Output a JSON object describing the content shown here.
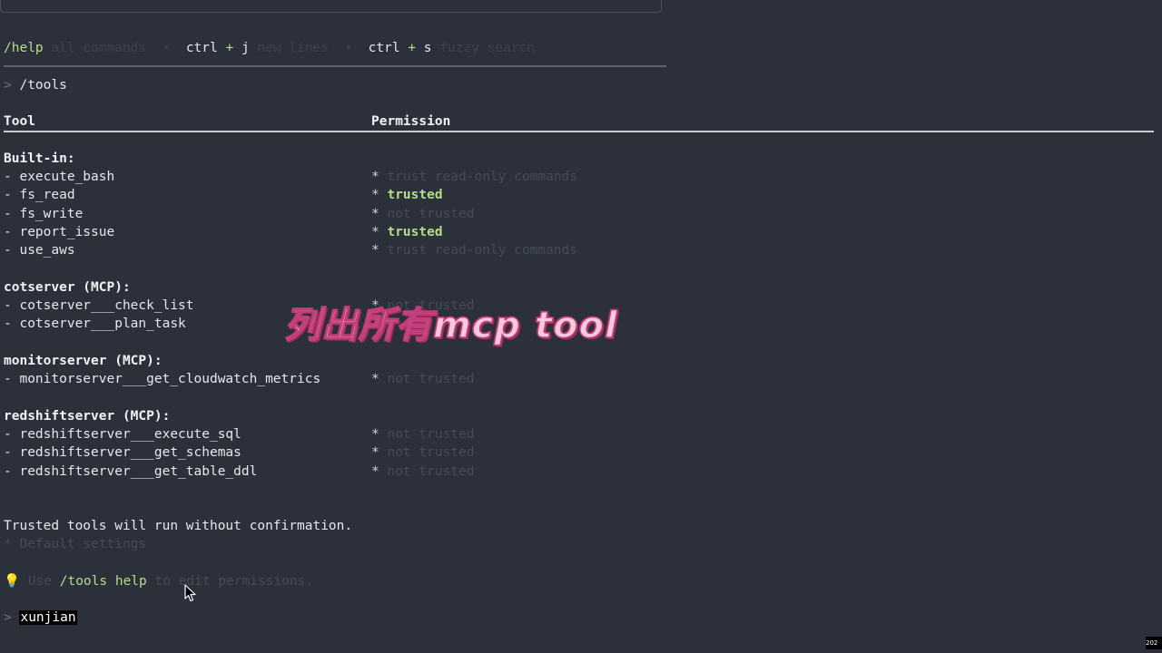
{
  "hint_bar": {
    "help_cmd": "/help",
    "help_desc": "all commands",
    "sep": "•",
    "newline_key1": "ctrl",
    "plus": "+",
    "newline_key2": "j",
    "newline_desc": "new lines",
    "search_key1": "ctrl",
    "search_key2": "s",
    "search_desc": "fuzzy search"
  },
  "prompt_marker": ">",
  "command": "/tools",
  "table": {
    "col_tool": "Tool",
    "col_permission": "Permission",
    "star": "*",
    "groups": [
      {
        "header": "Built-in:",
        "rows": [
          {
            "tool": "- execute_bash",
            "perm": "trust read-only commands",
            "trusted": false
          },
          {
            "tool": "- fs_read",
            "perm": "trusted",
            "trusted": true
          },
          {
            "tool": "- fs_write",
            "perm": "not trusted",
            "trusted": false
          },
          {
            "tool": "- report_issue",
            "perm": "trusted",
            "trusted": true
          },
          {
            "tool": "- use_aws",
            "perm": "trust read-only commands",
            "trusted": false
          }
        ]
      },
      {
        "header": "cotserver (MCP):",
        "rows": [
          {
            "tool": "- cotserver___check_list",
            "perm": "not trusted",
            "trusted": false
          },
          {
            "tool": "- cotserver___plan_task",
            "perm": "",
            "trusted": false
          }
        ]
      },
      {
        "header": "monitorserver (MCP):",
        "rows": [
          {
            "tool": "- monitorserver___get_cloudwatch_metrics",
            "perm": "not trusted",
            "trusted": false
          }
        ]
      },
      {
        "header": "redshiftserver (MCP):",
        "rows": [
          {
            "tool": "- redshiftserver___execute_sql",
            "perm": "not trusted",
            "trusted": false
          },
          {
            "tool": "- redshiftserver___get_schemas",
            "perm": "not trusted",
            "trusted": false
          },
          {
            "tool": "- redshiftserver___get_table_ddl",
            "perm": "not trusted",
            "trusted": false
          }
        ]
      }
    ]
  },
  "footer": {
    "trusted_note": "Trusted tools will run without confirmation.",
    "default_note": "* Default settings",
    "tip_prefix": "Use",
    "tip_cmd": "/tools help",
    "tip_suffix": "to edit permissions."
  },
  "input": {
    "prompt": ">",
    "value": "xunjian"
  },
  "overlay_caption": "列出所有mcp tool",
  "timestamp": "202",
  "colors": {
    "background": "#2b303a",
    "accent_green": "#b6dd8a",
    "caption_pink": "#f7c9de"
  },
  "icons": {
    "tip": "lightbulb-icon",
    "cursor": "mouse-cursor-icon"
  }
}
